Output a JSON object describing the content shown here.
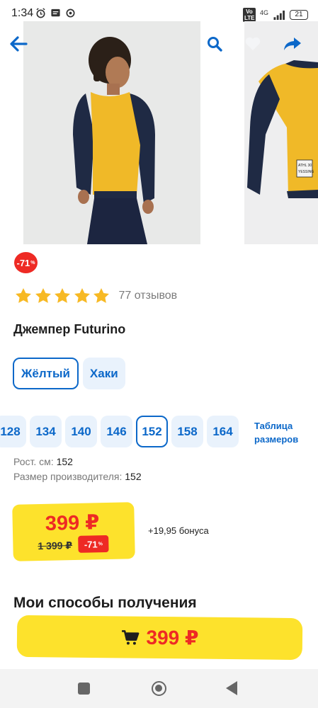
{
  "status_bar": {
    "time": "1:34",
    "network": "4G",
    "volte": "Vo LTE",
    "battery": "21"
  },
  "toolbar": {
    "back_icon": "arrow-left-icon",
    "search_icon": "search-icon",
    "favorite_icon": "heart-icon",
    "share_icon": "share-icon"
  },
  "gallery": {
    "photos": [
      "photo-child-sweater-front",
      "photo-sweater-flat"
    ],
    "tag_text_line1": "ATHL 30",
    "tag_text_line2": "YESSING"
  },
  "badge": {
    "discount": "-71",
    "percent": "%"
  },
  "rating": {
    "stars": 5,
    "reviews": "77 отзывов"
  },
  "product": {
    "title": "Джемпер Futurino"
  },
  "colors": [
    {
      "label": "Жёлтый",
      "selected": true
    },
    {
      "label": "Хаки",
      "selected": false
    }
  ],
  "sizes": [
    "128",
    "134",
    "140",
    "146",
    "152",
    "158",
    "164"
  ],
  "selected_size": "152",
  "size_table": {
    "line1": "Таблица",
    "line2": "размеров"
  },
  "specs": {
    "height_label": "Рост. см:",
    "height_value": "152",
    "maker_size_label": "Размер производителя:",
    "maker_size_value": "152"
  },
  "price": {
    "current": "399 ₽",
    "old": "1 399 ₽",
    "discount": "-71",
    "percent": "%",
    "bonus": "+19,95 бонуса"
  },
  "section": {
    "delivery_heading": "Мои способы получения"
  },
  "buy_button": {
    "price": "399 ₽",
    "icon": "cart-icon"
  },
  "colors_hex": {
    "accent_blue": "#0c68c9",
    "sale_red": "#ee2a24",
    "sticker_yellow": "#fde22c",
    "star": "#f7b924"
  }
}
